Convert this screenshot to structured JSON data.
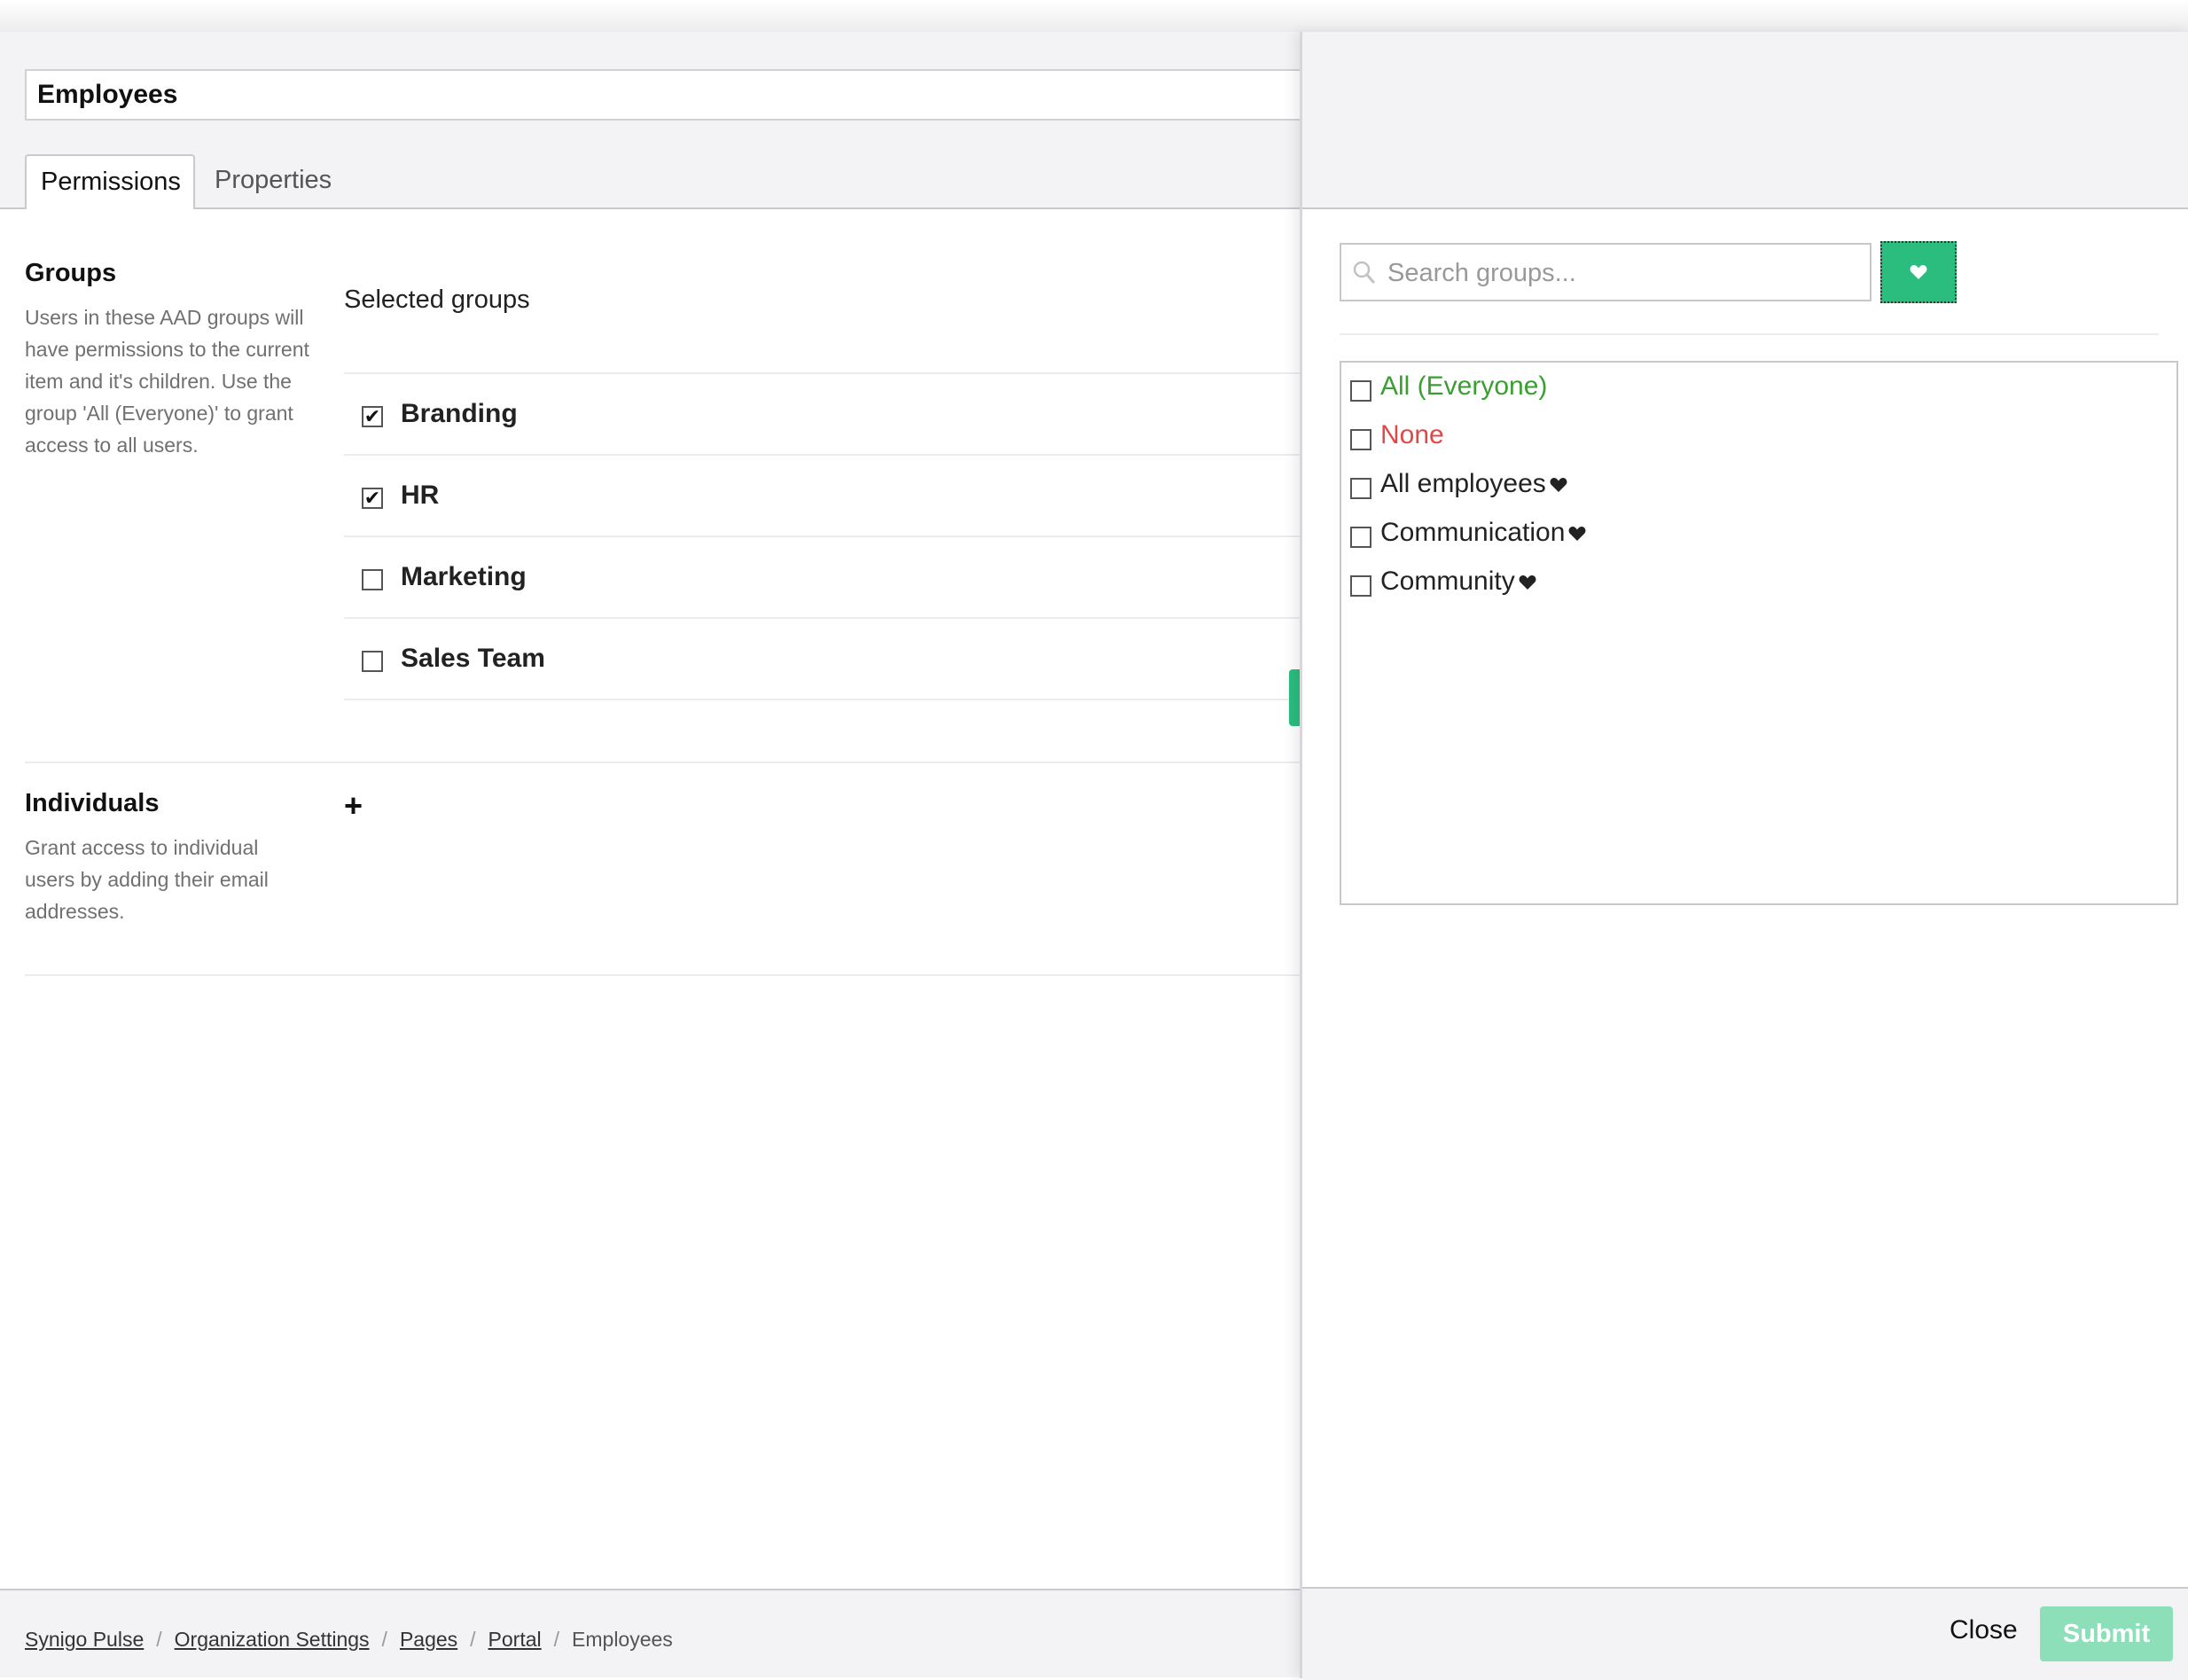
{
  "page": {
    "title_value": "Employees",
    "tabs": [
      {
        "label": "Permissions",
        "active": true
      },
      {
        "label": "Properties",
        "active": false
      }
    ]
  },
  "groups_section": {
    "title": "Groups",
    "description": "Users in these AAD groups will have permissions to the current item and it's children. Use the group 'All (Everyone)' to grant access to all users.",
    "selected_label": "Selected groups",
    "items": [
      {
        "name": "Branding",
        "checked": true
      },
      {
        "name": "HR",
        "checked": true
      },
      {
        "name": "Marketing",
        "checked": false
      },
      {
        "name": "Sales Team",
        "checked": false
      }
    ]
  },
  "individuals_section": {
    "title": "Individuals",
    "description": "Grant access to individual users by adding their email addresses.",
    "add_icon": "plus-icon"
  },
  "breadcrumb": {
    "items": [
      "Synigo Pulse",
      "Organization Settings",
      "Pages",
      "Portal"
    ],
    "current": "Employees"
  },
  "panel": {
    "search_placeholder": "Search groups...",
    "favorite_icon": "heart-icon",
    "list": [
      {
        "label": "All (Everyone)",
        "color": "#3a9e32",
        "favorite": false
      },
      {
        "label": "None",
        "color": "#e04848",
        "favorite": false
      },
      {
        "label": "All employees",
        "color": "#222222",
        "favorite": true
      },
      {
        "label": "Communication",
        "color": "#222222",
        "favorite": true
      },
      {
        "label": "Community",
        "color": "#222222",
        "favorite": true
      }
    ],
    "close_label": "Close",
    "submit_label": "Submit"
  },
  "colors": {
    "accent": "#2bbd7e",
    "accent_disabled": "#8ddfba",
    "everyone": "#3a9e32",
    "none": "#e04848"
  }
}
